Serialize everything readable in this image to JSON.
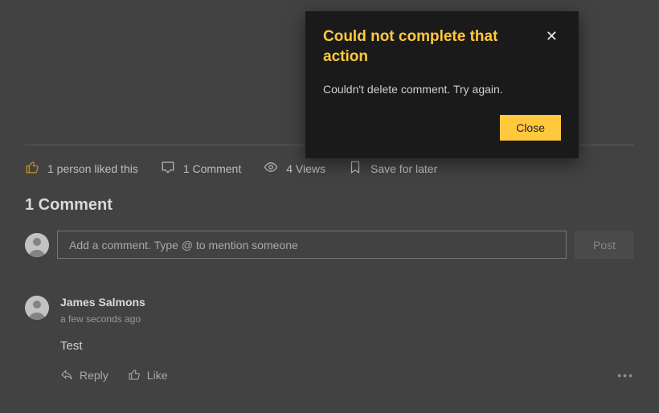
{
  "stats": {
    "likes_text": "1 person liked this",
    "comments_text": "1 Comment",
    "views_text": "4 Views",
    "save_text": "Save for later"
  },
  "section": {
    "heading": "1 Comment"
  },
  "compose": {
    "placeholder": "Add a comment. Type @ to mention someone",
    "post_label": "Post"
  },
  "comment": {
    "author": "James Salmons",
    "timestamp": "a few seconds ago",
    "text": "Test",
    "reply_label": "Reply",
    "like_label": "Like"
  },
  "toast": {
    "title": "Could not complete that action",
    "message": "Couldn't delete comment. Try again.",
    "close_label": "Close"
  },
  "colors": {
    "accent": "#ffc83d"
  }
}
